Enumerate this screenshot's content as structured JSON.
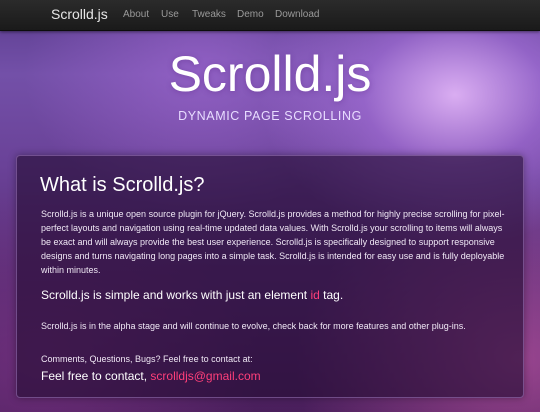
{
  "navbar": {
    "brand": "Scrolld.js",
    "links": [
      "About",
      "Use",
      "Tweaks",
      "Demo",
      "Download"
    ]
  },
  "hero": {
    "title": "Scrolld.js",
    "subtitle": "DYNAMIC PAGE SCROLLING"
  },
  "panel": {
    "heading": "What is Scrolld.js?",
    "description": "Scrolld.js is a unique open source plugin for jQuery. Scrolld.js provides a method for highly precise scrolling for pixel-perfect layouts and navigation using real-time updated data values. With Scrolld.js your scrolling to items will always be exact and will always provide the best user experience. Scrolld.js is specifically designed to support responsive designs and turns navigating long pages into a simple task. Scrolld.js is intended for easy use and is fully deployable within minutes.",
    "simple_prefix": "Scrolld.js is simple and works with just an element",
    "simple_accent": "id",
    "simple_suffix": "tag.",
    "alpha_note": "Scrolld.js is in the alpha stage and will continue to evolve, check back for more features and other plug-ins.",
    "contact_note": "Comments, Questions, Bugs? Feel free to contact at:",
    "contact_prefix": "Feel free to contact,",
    "contact_email": "scrolldjs@gmail.com"
  },
  "colors": {
    "accent": "#ff3f7a",
    "navbar_bg": "#222222",
    "panel_bg": "#2a0f3a"
  }
}
